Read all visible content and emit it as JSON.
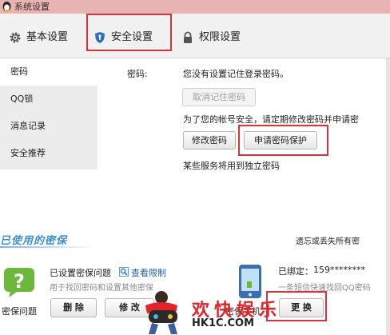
{
  "window": {
    "title": "系统设置",
    "icon": "qq-penguin-icon"
  },
  "tabs": [
    {
      "label": "基本设置",
      "icon": "gear-icon"
    },
    {
      "label": "安全设置",
      "icon": "shield-icon",
      "active": true
    },
    {
      "label": "权限设置",
      "icon": "lock-icon"
    }
  ],
  "sidebar": {
    "items": [
      {
        "label": "密码",
        "active": true
      },
      {
        "label": "QQ锁"
      },
      {
        "label": "消息记录"
      },
      {
        "label": "安全推荐"
      }
    ]
  },
  "password": {
    "label": "密码:",
    "status_text": "您没有设置记住登录密码。",
    "cancel_remember_label": "取消记住密码",
    "security_note": "为了您的帐号安全，请定期修改密码并申请密",
    "change_password_label": "修改密码",
    "apply_protection_label": "申请密码保护",
    "independent_note": "某些服务将用到独立密码"
  },
  "protection": {
    "section_title": "已使用的密保",
    "forgot_note": "遗忘或丢失所有密",
    "question": {
      "label": "密保问题",
      "status": "已设置密保问题",
      "view_limit": "查看限制",
      "desc": "用于找回密码和设置其他密保",
      "delete_label": "删 除",
      "modify_label": "修 改"
    },
    "phone": {
      "label": "密保手机",
      "status": "已绑定：",
      "number": "159********",
      "desc": "一条短信快速找回QQ密码",
      "change_label": "更 换"
    }
  },
  "watermark": {
    "text": "欢快娱乐",
    "url": "HK1C.COM"
  },
  "colors": {
    "titlebar": "#e7b4b3",
    "highlight_box": "#d8333a",
    "section_title": "#3f8fcf",
    "link": "#1d5ea8",
    "watermark": "#e2232a"
  }
}
